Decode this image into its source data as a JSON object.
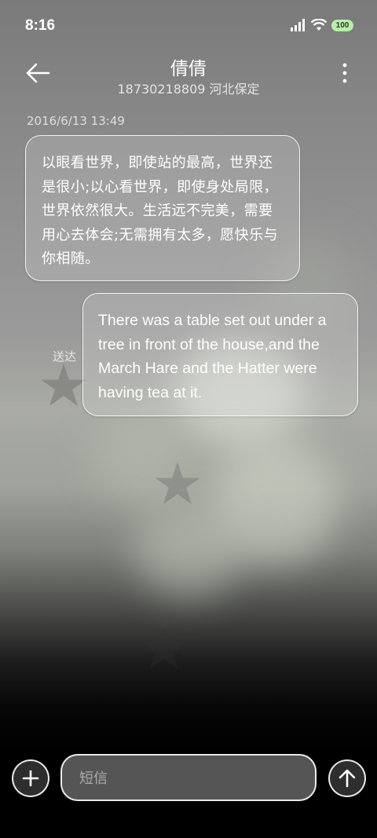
{
  "status_bar": {
    "time": "8:16",
    "battery": "100",
    "icons": [
      "signal-icon",
      "wifi-icon",
      "battery-icon"
    ]
  },
  "header": {
    "contact_name": "倩倩",
    "contact_detail": "18730218809 河北保定",
    "back_icon": "arrow-left-icon",
    "more_icon": "more-vertical-icon"
  },
  "conversation": {
    "timestamp": "2016/6/13 13:49",
    "messages": [
      {
        "direction": "incoming",
        "text": "以眼看世界，即使站的最高，世界还是很小;以心看世界，即使身处局限，世界依然很大。生活远不完美，需要用心去体会;无需拥有太多，愿快乐与你相随。"
      },
      {
        "direction": "outgoing",
        "status": "送达",
        "text": "There was a table set out under a tree in front of the house,and the March Hare and the Hatter were having tea at it."
      }
    ]
  },
  "composer": {
    "placeholder": "短信",
    "add_icon": "plus-icon",
    "send_icon": "arrow-up-icon"
  },
  "colors": {
    "bubble_border": "#ffffff",
    "battery": "#b6f0a6"
  }
}
